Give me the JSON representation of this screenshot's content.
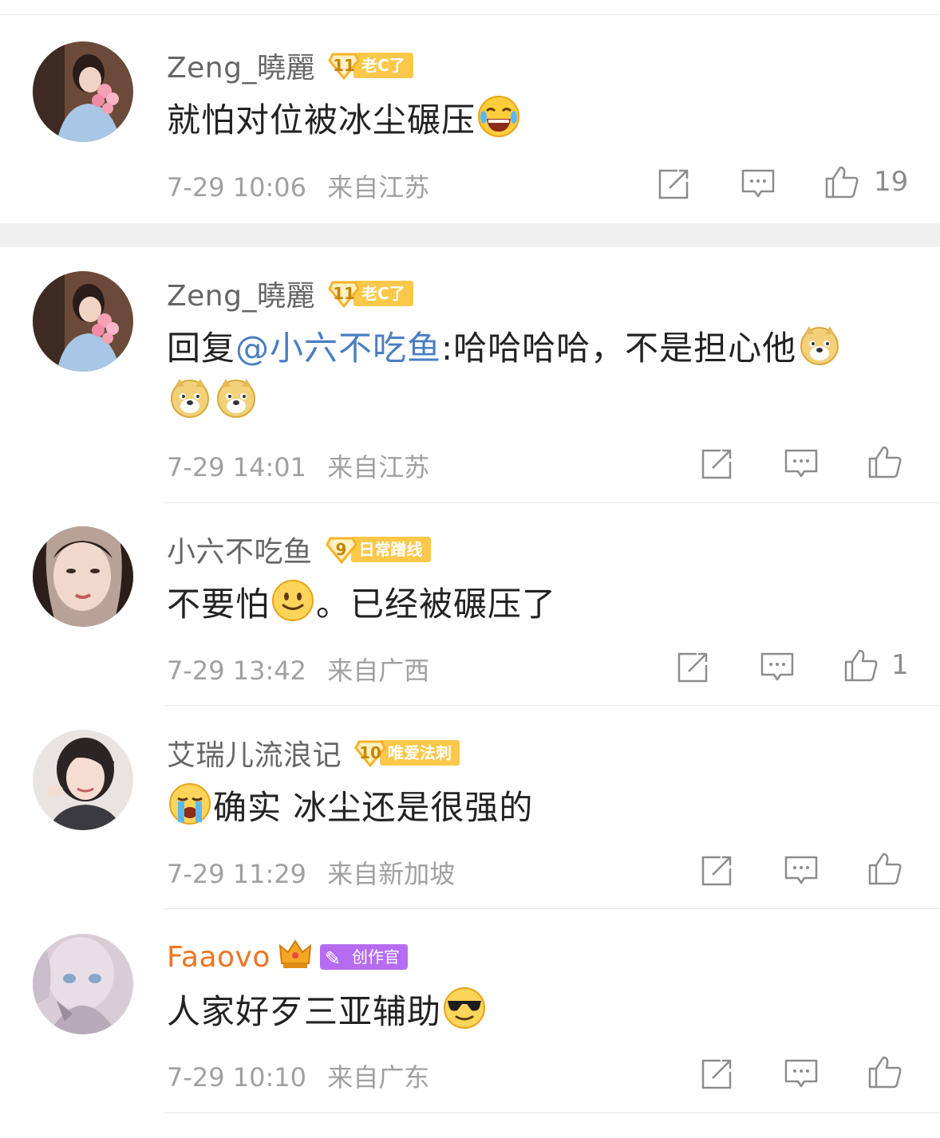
{
  "comments": [
    {
      "username": "Zeng_曉麗",
      "badge_level": "11",
      "badge_label": "老C了",
      "text": "就怕对位被冰尘碾压",
      "time": "7-29 10:06",
      "location": "来自江苏",
      "likes": "19"
    },
    {
      "username": "Zeng_曉麗",
      "badge_level": "11",
      "badge_label": "老C了",
      "reply_prefix": "回复",
      "mention": "@小六不吃鱼",
      "text": ":哈哈哈哈，不是担心他",
      "time": "7-29 14:01",
      "location": "来自江苏",
      "likes": ""
    },
    {
      "username": "小六不吃鱼",
      "badge_level": "9",
      "badge_label": "日常蹭线",
      "text_before": "不要怕",
      "text_after": "。已经被碾压了",
      "time": "7-29 13:42",
      "location": "来自广西",
      "likes": "1"
    },
    {
      "username": "艾瑞儿流浪记",
      "badge_level": "10",
      "badge_label": "唯爱法刺",
      "text": "确实 冰尘还是很强的",
      "time": "7-29 11:29",
      "location": "来自新加坡",
      "likes": ""
    },
    {
      "username": "Faaovo",
      "badge_label": "创作官",
      "text": "人家好歹三亚辅助",
      "time": "7-29 10:10",
      "location": "来自广东",
      "likes": ""
    }
  ],
  "icons": {
    "share": "share-icon",
    "comment": "comment-icon",
    "like": "thumbs-up-icon"
  },
  "colors": {
    "mention": "#4a7ec2",
    "badge": "#fcc84a",
    "creator_badge": "#b66cf0",
    "vip_name": "#ef7422"
  }
}
